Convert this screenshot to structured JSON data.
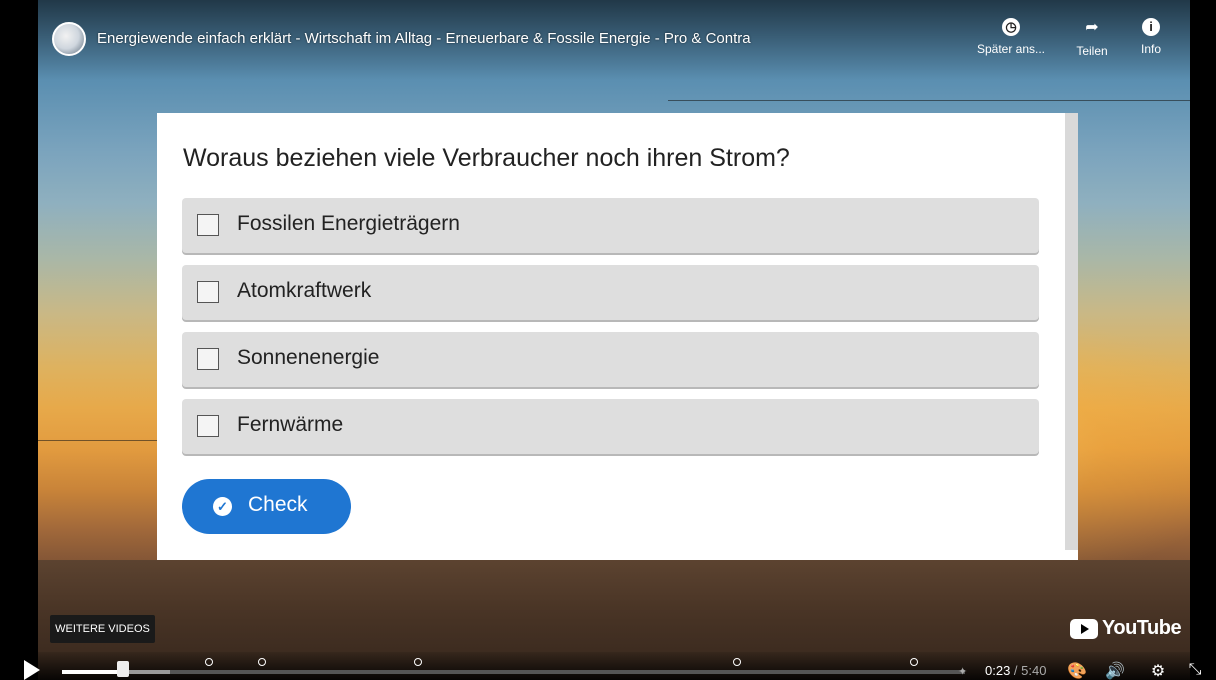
{
  "video": {
    "title": "Energiewende einfach erklärt - Wirtschaft im Alltag - Erneuerbare & Fossile Energie - Pro & Contra",
    "actions": [
      {
        "icon": "clock-icon",
        "label": "Später ans..."
      },
      {
        "icon": "share-icon",
        "label": "Teilen"
      },
      {
        "icon": "info-icon",
        "label": "Info"
      }
    ]
  },
  "quiz": {
    "question": "Woraus beziehen viele Verbraucher noch ihren Strom?",
    "answers": [
      {
        "label": "Fossilen Energieträgern",
        "checked": false
      },
      {
        "label": "Atomkraftwerk",
        "checked": false
      },
      {
        "label": "Sonnenenergie",
        "checked": false
      },
      {
        "label": "Fernwärme",
        "checked": false
      }
    ],
    "check_label": "Check",
    "check_color": "#1f76d2"
  },
  "overlay": {
    "more_videos": "WEITERE VIDEOS",
    "brand": "YouTube"
  },
  "player": {
    "current_time": "0:23",
    "separator": " / ",
    "duration": "5:40",
    "progress_fraction": 0.068,
    "buffered_fraction": 0.12,
    "chapter_fractions": [
      0.163,
      0.222,
      0.394,
      0.748,
      0.943
    ]
  }
}
